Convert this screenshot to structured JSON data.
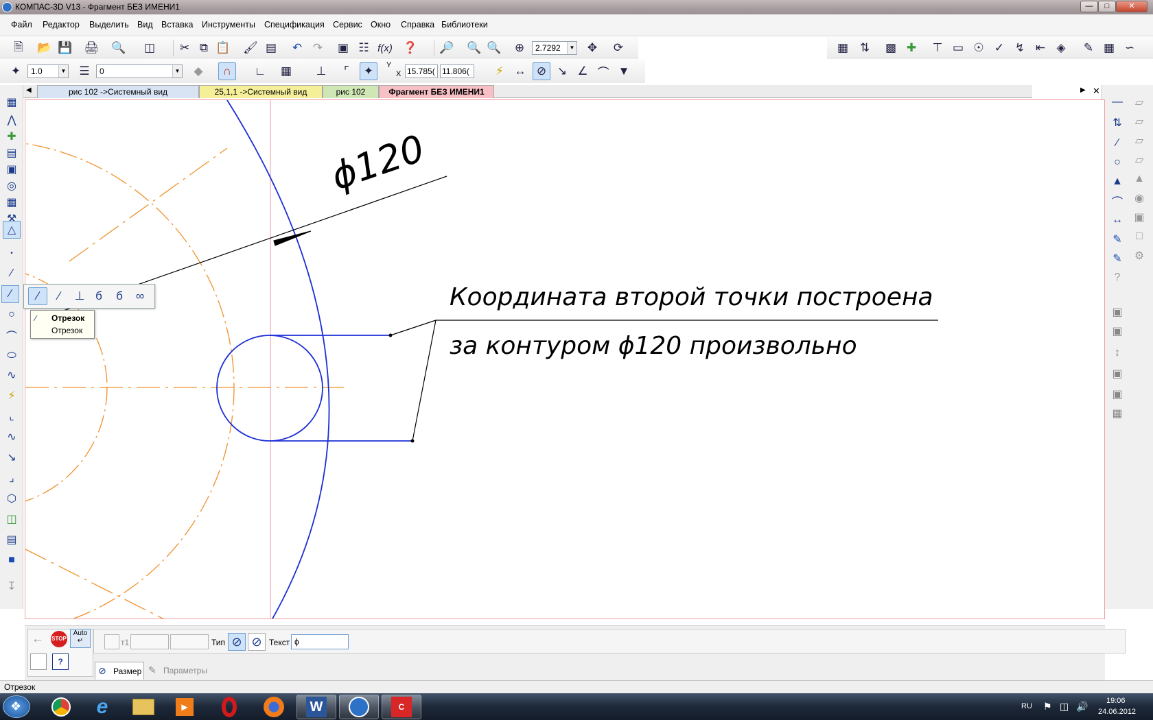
{
  "window": {
    "title": "КОМПАС-3D V13 - Фрагмент БЕЗ ИМЕНИ1",
    "controls": [
      "minimize",
      "maximize",
      "close"
    ]
  },
  "menu": [
    "Файл",
    "Редактор",
    "Выделить",
    "Вид",
    "Вставка",
    "Инструменты",
    "Спецификация",
    "Сервис",
    "Окно",
    "Справка",
    "Библиотеки"
  ],
  "toolbar": {
    "zoom_value": "2.7292",
    "step_value": "1.0",
    "layer_value": "0",
    "coord_y_label": "Y",
    "coord_x_label": "X",
    "coord_x": "15.785(",
    "coord_y": "11.806("
  },
  "tabs": [
    {
      "label": "рис 102 ->Системный вид",
      "color": "#d8e4f4"
    },
    {
      "label": "25,1,1 ->Системный вид",
      "color": "#f5ef9a"
    },
    {
      "label": "рис 102",
      "color": "#cfe7b5"
    },
    {
      "label": "Фрагмент БЕЗ ИМЕНИ1",
      "color": "#f6c0c4",
      "active": true
    }
  ],
  "drawing": {
    "dimension_text": "ϕ120",
    "annotation_line1": "Координата второй точки построена",
    "annotation_line2": "за контуром ϕ120 произвольно",
    "colors": {
      "construction": "#f0902a",
      "main": "#1c2fd6",
      "axis": "#e89aaa",
      "dimension": "#000000"
    }
  },
  "flyout_tooltip": {
    "title": "Отрезок",
    "subtitle": "Отрезок"
  },
  "property_bar": {
    "t1_label": "т1",
    "type_label": "Тип",
    "text_label": "Текст",
    "text_value": "ϕ",
    "auto_label": "Auto",
    "stop_label": "STOP",
    "tab_size": "Размер",
    "tab_params": "Параметры"
  },
  "status_text": "Отрезок",
  "taskbar": {
    "language": "RU",
    "time": "19:06",
    "date": "24.06.2012",
    "apps": [
      "start",
      "chrome",
      "internet-explorer",
      "file-explorer",
      "media-player",
      "opera",
      "firefox",
      "word",
      "kompas",
      "kompas-alt"
    ]
  }
}
